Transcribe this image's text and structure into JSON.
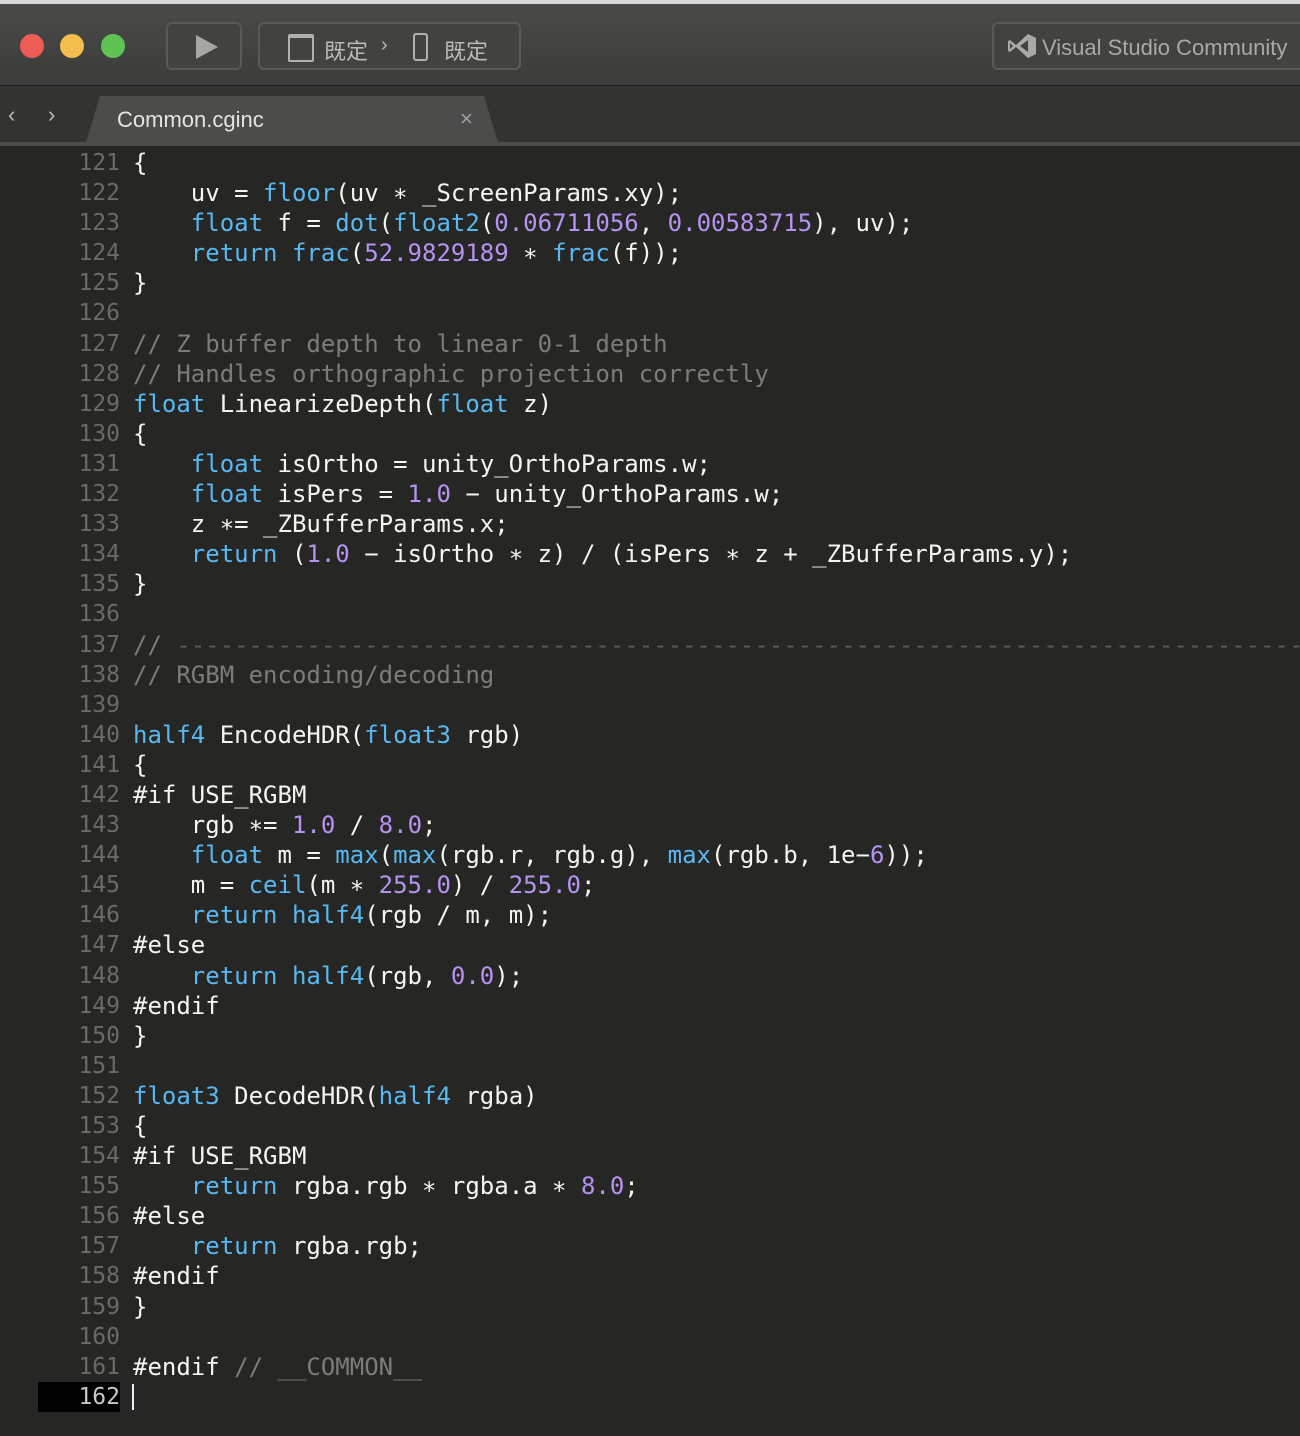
{
  "toolbar": {
    "config_left": "既定",
    "config_separator": "›",
    "config_right": "既定",
    "ide_label": "Visual Studio Community"
  },
  "tabs": {
    "back_arrow": "‹",
    "forward_arrow": "›",
    "active_tab": "Common.cginc",
    "close_glyph": "×"
  },
  "editor": {
    "current_line": 162,
    "lines": [
      {
        "n": "121",
        "tokens": [
          [
            "{",
            "norm"
          ]
        ]
      },
      {
        "n": "122",
        "tokens": [
          [
            "    uv = ",
            "norm"
          ],
          [
            "floor",
            "kw"
          ],
          [
            "(uv ∗ _ScreenParams.xy);",
            "norm"
          ]
        ]
      },
      {
        "n": "123",
        "tokens": [
          [
            "    ",
            "norm"
          ],
          [
            "float",
            "kw"
          ],
          [
            " f = ",
            "norm"
          ],
          [
            "dot",
            "kw"
          ],
          [
            "(",
            "norm"
          ],
          [
            "float2",
            "kw"
          ],
          [
            "(",
            "norm"
          ],
          [
            "0.06711056",
            "num"
          ],
          [
            ", ",
            "norm"
          ],
          [
            "0.00583715",
            "num"
          ],
          [
            "), uv);",
            "norm"
          ]
        ]
      },
      {
        "n": "124",
        "tokens": [
          [
            "    ",
            "norm"
          ],
          [
            "return",
            "kw"
          ],
          [
            " ",
            "norm"
          ],
          [
            "frac",
            "kw"
          ],
          [
            "(",
            "norm"
          ],
          [
            "52.9829189",
            "num"
          ],
          [
            " ∗ ",
            "norm"
          ],
          [
            "frac",
            "kw"
          ],
          [
            "(f));",
            "norm"
          ]
        ]
      },
      {
        "n": "125",
        "tokens": [
          [
            "}",
            "norm"
          ]
        ]
      },
      {
        "n": "126",
        "tokens": []
      },
      {
        "n": "127",
        "tokens": [
          [
            "// Z buffer depth to linear 0-1 depth",
            "com"
          ]
        ]
      },
      {
        "n": "128",
        "tokens": [
          [
            "// Handles orthographic projection correctly",
            "com"
          ]
        ]
      },
      {
        "n": "129",
        "tokens": [
          [
            "float",
            "kw"
          ],
          [
            " LinearizeDepth(",
            "norm"
          ],
          [
            "float",
            "kw"
          ],
          [
            " z)",
            "norm"
          ]
        ]
      },
      {
        "n": "130",
        "tokens": [
          [
            "{",
            "norm"
          ]
        ]
      },
      {
        "n": "131",
        "tokens": [
          [
            "    ",
            "norm"
          ],
          [
            "float",
            "kw"
          ],
          [
            " isOrtho = unity_OrthoParams.w;",
            "norm"
          ]
        ]
      },
      {
        "n": "132",
        "tokens": [
          [
            "    ",
            "norm"
          ],
          [
            "float",
            "kw"
          ],
          [
            " isPers = ",
            "norm"
          ],
          [
            "1.0",
            "num"
          ],
          [
            " − unity_OrthoParams.w;",
            "norm"
          ]
        ]
      },
      {
        "n": "133",
        "tokens": [
          [
            "    z ∗= _ZBufferParams.x;",
            "norm"
          ]
        ]
      },
      {
        "n": "134",
        "tokens": [
          [
            "    ",
            "norm"
          ],
          [
            "return",
            "kw"
          ],
          [
            " (",
            "norm"
          ],
          [
            "1.0",
            "num"
          ],
          [
            " − isOrtho ∗ z) / (isPers ∗ z + _ZBufferParams.y);",
            "norm"
          ]
        ]
      },
      {
        "n": "135",
        "tokens": [
          [
            "}",
            "norm"
          ]
        ]
      },
      {
        "n": "136",
        "tokens": []
      },
      {
        "n": "137",
        "tokens": [
          [
            "// ",
            "com"
          ],
          [
            "------------------------------------------------------------------------------------",
            "dash"
          ]
        ]
      },
      {
        "n": "138",
        "tokens": [
          [
            "// RGBM encoding/decoding",
            "com"
          ]
        ]
      },
      {
        "n": "139",
        "tokens": []
      },
      {
        "n": "140",
        "tokens": [
          [
            "half4",
            "kw"
          ],
          [
            " EncodeHDR(",
            "norm"
          ],
          [
            "float3",
            "kw"
          ],
          [
            " rgb)",
            "norm"
          ]
        ]
      },
      {
        "n": "141",
        "tokens": [
          [
            "{",
            "norm"
          ]
        ]
      },
      {
        "n": "142",
        "tokens": [
          [
            "#if",
            "pre"
          ],
          [
            " USE_RGBM",
            "norm"
          ]
        ]
      },
      {
        "n": "143",
        "tokens": [
          [
            "    rgb ∗= ",
            "norm"
          ],
          [
            "1.0",
            "num"
          ],
          [
            " / ",
            "norm"
          ],
          [
            "8.0",
            "num"
          ],
          [
            ";",
            "norm"
          ]
        ]
      },
      {
        "n": "144",
        "tokens": [
          [
            "    ",
            "norm"
          ],
          [
            "float",
            "kw"
          ],
          [
            " m = ",
            "norm"
          ],
          [
            "max",
            "kw"
          ],
          [
            "(",
            "norm"
          ],
          [
            "max",
            "kw"
          ],
          [
            "(rgb.r, rgb.g), ",
            "norm"
          ],
          [
            "max",
            "kw"
          ],
          [
            "(rgb.b, 1e−",
            "norm"
          ],
          [
            "6",
            "num"
          ],
          [
            "));",
            "norm"
          ]
        ]
      },
      {
        "n": "145",
        "tokens": [
          [
            "    m = ",
            "norm"
          ],
          [
            "ceil",
            "kw"
          ],
          [
            "(m ∗ ",
            "norm"
          ],
          [
            "255.0",
            "num"
          ],
          [
            ") / ",
            "norm"
          ],
          [
            "255.0",
            "num"
          ],
          [
            ";",
            "norm"
          ]
        ]
      },
      {
        "n": "146",
        "tokens": [
          [
            "    ",
            "norm"
          ],
          [
            "return",
            "kw"
          ],
          [
            " ",
            "norm"
          ],
          [
            "half4",
            "kw"
          ],
          [
            "(rgb / m, m);",
            "norm"
          ]
        ]
      },
      {
        "n": "147",
        "tokens": [
          [
            "#else",
            "pre"
          ]
        ]
      },
      {
        "n": "148",
        "tokens": [
          [
            "    ",
            "norm"
          ],
          [
            "return",
            "kw"
          ],
          [
            " ",
            "norm"
          ],
          [
            "half4",
            "kw"
          ],
          [
            "(rgb, ",
            "norm"
          ],
          [
            "0.0",
            "num"
          ],
          [
            ");",
            "norm"
          ]
        ]
      },
      {
        "n": "149",
        "tokens": [
          [
            "#endif",
            "pre"
          ]
        ]
      },
      {
        "n": "150",
        "tokens": [
          [
            "}",
            "norm"
          ]
        ]
      },
      {
        "n": "151",
        "tokens": []
      },
      {
        "n": "152",
        "tokens": [
          [
            "float3",
            "kw"
          ],
          [
            " DecodeHDR(",
            "norm"
          ],
          [
            "half4",
            "kw"
          ],
          [
            " rgba)",
            "norm"
          ]
        ]
      },
      {
        "n": "153",
        "tokens": [
          [
            "{",
            "norm"
          ]
        ]
      },
      {
        "n": "154",
        "tokens": [
          [
            "#if",
            "pre"
          ],
          [
            " USE_RGBM",
            "norm"
          ]
        ]
      },
      {
        "n": "155",
        "tokens": [
          [
            "    ",
            "norm"
          ],
          [
            "return",
            "kw"
          ],
          [
            " rgba.rgb ∗ rgba.a ∗ ",
            "norm"
          ],
          [
            "8.0",
            "num"
          ],
          [
            ";",
            "norm"
          ]
        ]
      },
      {
        "n": "156",
        "tokens": [
          [
            "#else",
            "pre"
          ]
        ]
      },
      {
        "n": "157",
        "tokens": [
          [
            "    ",
            "norm"
          ],
          [
            "return",
            "kw"
          ],
          [
            " rgba.rgb;",
            "norm"
          ]
        ]
      },
      {
        "n": "158",
        "tokens": [
          [
            "#endif",
            "pre"
          ]
        ]
      },
      {
        "n": "159",
        "tokens": [
          [
            "}",
            "norm"
          ]
        ]
      },
      {
        "n": "160",
        "tokens": []
      },
      {
        "n": "161",
        "tokens": [
          [
            "#endif",
            "pre"
          ],
          [
            " // __COMMON__",
            "com"
          ]
        ]
      },
      {
        "n": "162",
        "tokens": []
      }
    ]
  }
}
